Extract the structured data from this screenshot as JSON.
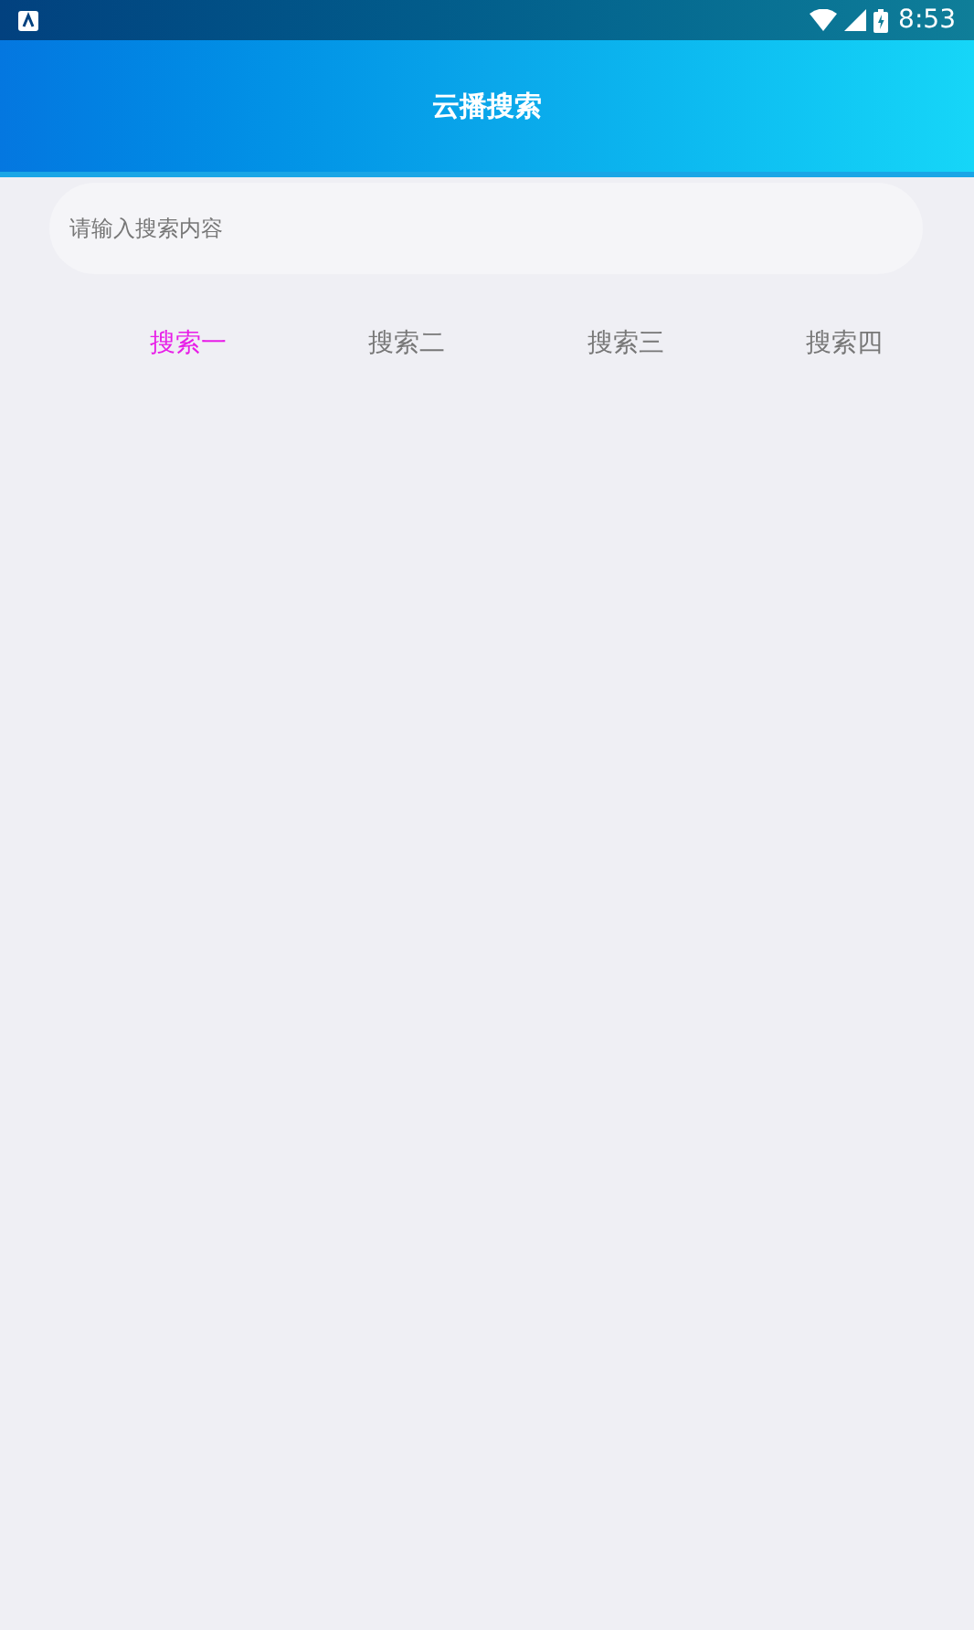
{
  "status_bar": {
    "time": "8:53"
  },
  "header": {
    "title": "云播搜索"
  },
  "search": {
    "placeholder": "请输入搜索内容"
  },
  "tabs": [
    {
      "label": "搜索一",
      "selected": true
    },
    {
      "label": "搜索二",
      "selected": false
    },
    {
      "label": "搜索三",
      "selected": false
    },
    {
      "label": "搜索四",
      "selected": false
    }
  ]
}
